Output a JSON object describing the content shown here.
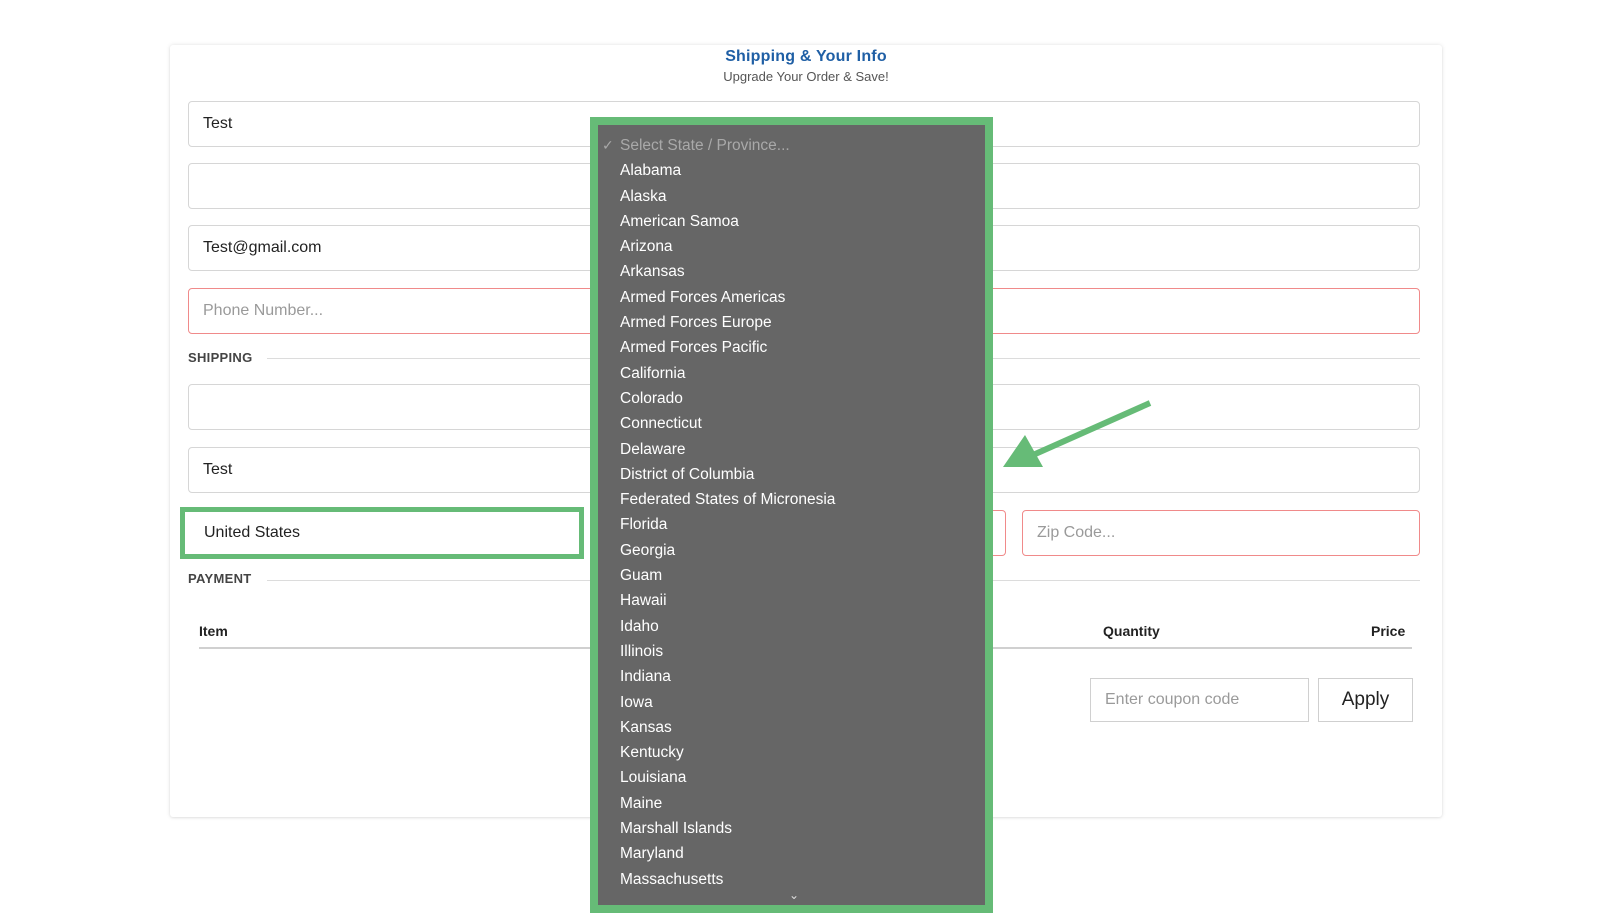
{
  "header": {
    "title": "Shipping & Your Info",
    "subtitle": "Upgrade Your Order & Save!"
  },
  "fields": {
    "first_name": "Test",
    "last_name": "",
    "email": "Test@gmail.com",
    "phone_placeholder": "Phone Number...",
    "address": "",
    "city": "Test",
    "country": "United States",
    "zip_placeholder": "Zip Code..."
  },
  "sections": {
    "shipping": "SHIPPING",
    "payment": "PAYMENT"
  },
  "table": {
    "columns": [
      "Item",
      "Quantity",
      "Price"
    ]
  },
  "coupon": {
    "placeholder": "Enter coupon code",
    "apply_label": "Apply"
  },
  "state_dropdown": {
    "check_glyph": "✓",
    "placeholder": "Select State / Province...",
    "options": [
      "Alabama",
      "Alaska",
      "American Samoa",
      "Arizona",
      "Arkansas",
      "Armed Forces Americas",
      "Armed Forces Europe",
      "Armed Forces Pacific",
      "California",
      "Colorado",
      "Connecticut",
      "Delaware",
      "District of Columbia",
      "Federated States of Micronesia",
      "Florida",
      "Georgia",
      "Guam",
      "Hawaii",
      "Idaho",
      "Illinois",
      "Indiana",
      "Iowa",
      "Kansas",
      "Kentucky",
      "Louisiana",
      "Maine",
      "Marshall Islands",
      "Maryland",
      "Massachusetts"
    ]
  },
  "colors": {
    "title": "#1f5fa5",
    "highlight": "#66bb77",
    "dropdown_bg": "#666666",
    "error_border": "#f08a8a"
  }
}
